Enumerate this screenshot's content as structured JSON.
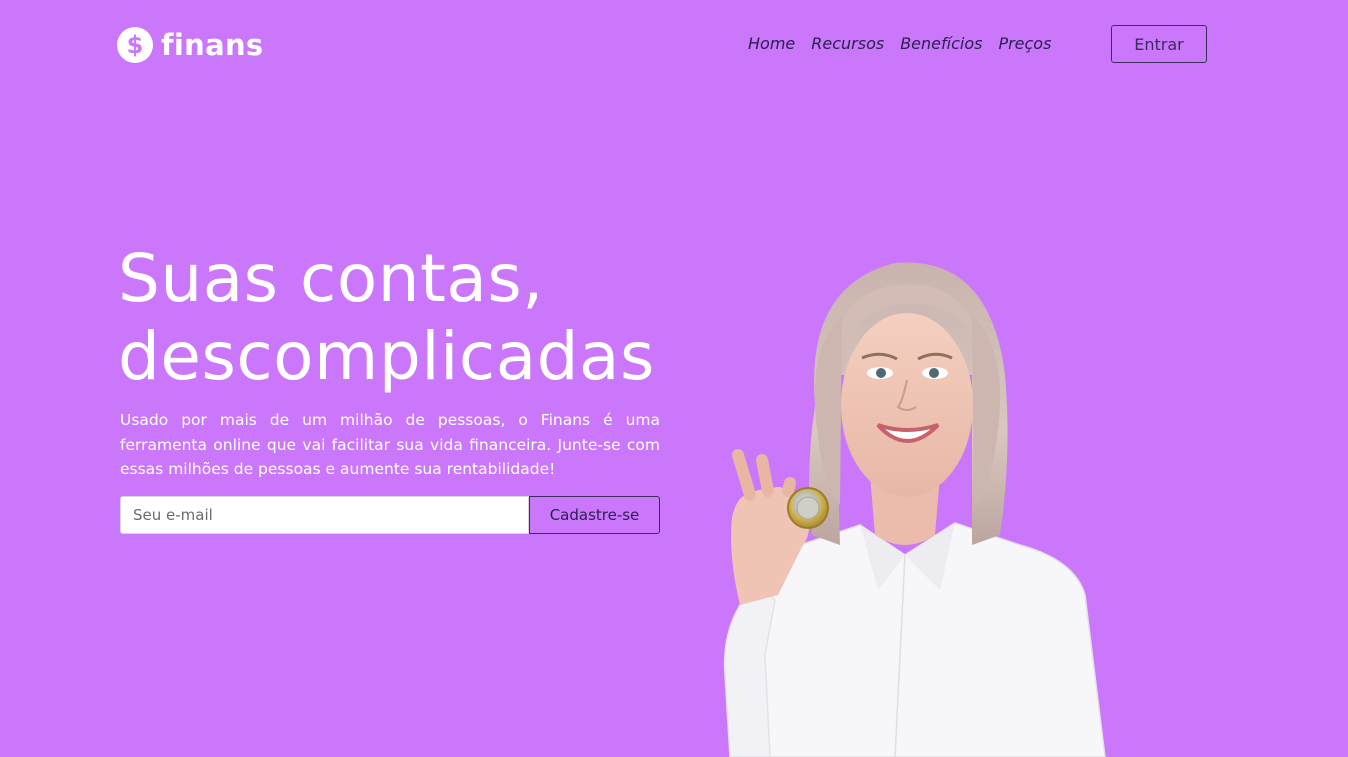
{
  "header": {
    "logo_symbol": "$",
    "logo_text": "finans",
    "nav": [
      {
        "label": "Home"
      },
      {
        "label": "Recursos"
      },
      {
        "label": "Benefícios"
      },
      {
        "label": "Preços"
      }
    ],
    "login_label": "Entrar"
  },
  "hero": {
    "title_line1": "Suas contas,",
    "title_line2": "descomplicadas",
    "description": "Usado por mais de um milhão de pessoas, o Finans é uma ferramenta online que vai facilitar sua vida financeira. Junte-se com essas milhões de pessoas e aumente sua rentabilidade!",
    "email_placeholder": "Seu e-mail",
    "email_value": "",
    "signup_label": "Cadastre-se"
  },
  "colors": {
    "background": "#cb77fc",
    "accent_dark": "#2a2050",
    "white": "#ffffff"
  },
  "image": {
    "subject": "smiling-woman-holding-coin-photo"
  }
}
